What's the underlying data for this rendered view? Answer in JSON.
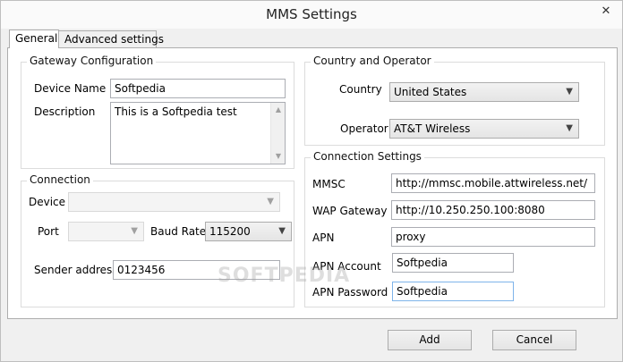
{
  "window": {
    "title": "MMS Settings",
    "close_glyph": "✕"
  },
  "tabs": [
    {
      "label": "General",
      "active": true
    },
    {
      "label": "Advanced settings",
      "active": false
    }
  ],
  "gateway": {
    "title": "Gateway Configuration",
    "device_name_label": "Device Name",
    "device_name_value": "Softpedia",
    "description_label": "Description",
    "description_value": "This is a Softpedia test"
  },
  "connection": {
    "title": "Connection",
    "device_label": "Device",
    "device_value": "",
    "port_label": "Port",
    "port_value": "",
    "baud_label": "Baud Rate",
    "baud_value": "115200",
    "sender_label": "Sender address",
    "sender_value": "0123456"
  },
  "country": {
    "title": "Country and Operator",
    "country_label": "Country",
    "country_value": "United States",
    "operator_label": "Operator",
    "operator_value": "AT&T Wireless"
  },
  "settings": {
    "title": "Connection Settings",
    "mmsc_label": "MMSC",
    "mmsc_value": "http://mmsc.mobile.attwireless.net/",
    "wap_label": "WAP Gateway",
    "wap_value": "http://10.250.250.100:8080",
    "apn_label": "APN",
    "apn_value": "proxy",
    "account_label": "APN Account",
    "account_value": "Softpedia",
    "password_label": "APN Password",
    "password_value": "Softpedia"
  },
  "buttons": {
    "add": "Add",
    "cancel": "Cancel"
  },
  "icons": {
    "dropdown": "chevron-down-icon",
    "scroll_up": "scroll-up-icon",
    "scroll_down": "scroll-down-icon",
    "close": "close-icon"
  },
  "watermark": "SOFTPEDIA"
}
